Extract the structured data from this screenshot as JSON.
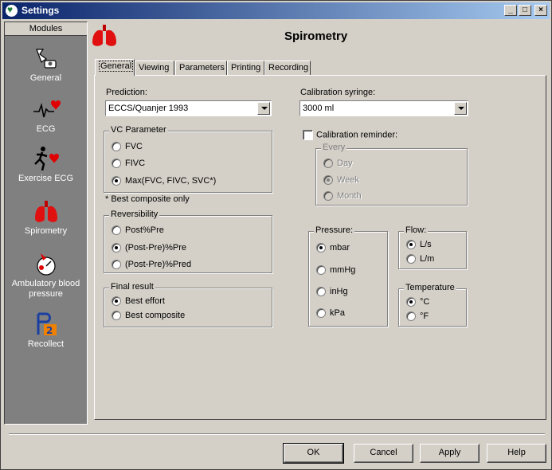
{
  "window": {
    "title": "Settings",
    "buttons": {
      "minimize": "_",
      "maximize": "□",
      "close": "×"
    }
  },
  "sidebar": {
    "header": "Modules",
    "items": [
      {
        "label": "General",
        "icon": "general-icon"
      },
      {
        "label": "ECG",
        "icon": "ecg-icon"
      },
      {
        "label": "Exercise ECG",
        "icon": "exercise-ecg-icon"
      },
      {
        "label": "Spirometry",
        "icon": "lungs-icon"
      },
      {
        "label": "Ambulatory blood pressure",
        "icon": "blood-pressure-icon"
      },
      {
        "label": "Recollect",
        "icon": "recollect-icon"
      }
    ]
  },
  "page": {
    "title": "Spirometry",
    "icon": "lungs-icon"
  },
  "tabs": [
    {
      "label": "General",
      "active": true
    },
    {
      "label": "Viewing"
    },
    {
      "label": "Parameters"
    },
    {
      "label": "Printing"
    },
    {
      "label": "Recording"
    }
  ],
  "prediction": {
    "label": "Prediction:",
    "value": "ECCS/Quanjer 1993"
  },
  "vc_parameter": {
    "legend": "VC Parameter",
    "options": [
      "FVC",
      "FIVC",
      "Max(FVC, FIVC, SVC*)"
    ],
    "selected": 2,
    "note": "* Best composite only"
  },
  "reversibility": {
    "legend": "Reversibility",
    "options": [
      "Post%Pre",
      "(Post-Pre)%Pre",
      "(Post-Pre)%Pred"
    ],
    "selected": 1
  },
  "final_result": {
    "legend": "Final result",
    "options": [
      "Best effort",
      "Best composite"
    ],
    "selected": 0
  },
  "calibration_syringe": {
    "label": "Calibration syringe:",
    "value": "3000 ml"
  },
  "calibration_reminder": {
    "label": "Calibration reminder:",
    "checked": false,
    "every_legend": "Every",
    "options": [
      "Day",
      "Week",
      "Month"
    ],
    "selected": 1
  },
  "pressure": {
    "legend": "Pressure:",
    "options": [
      "mbar",
      "mmHg",
      "inHg",
      "kPa"
    ],
    "selected": 0
  },
  "flow": {
    "legend": "Flow:",
    "options": [
      "L/s",
      "L/m"
    ],
    "selected": 0
  },
  "temperature": {
    "legend": "Temperature",
    "options": [
      "°C",
      "°F"
    ],
    "selected": 0
  },
  "buttons": {
    "ok": "OK",
    "cancel": "Cancel",
    "apply": "Apply",
    "help": "Help"
  }
}
